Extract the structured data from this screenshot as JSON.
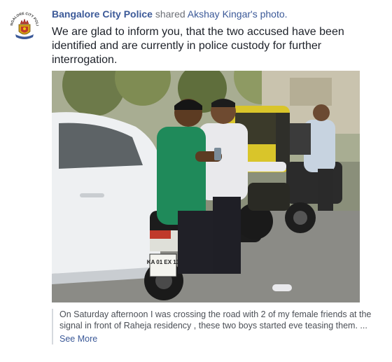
{
  "post": {
    "author": "Bangalore City Police",
    "action": "shared",
    "original_owner": "Akshay Kingar's",
    "object": "photo.",
    "message": "We are glad to inform you, that the two accused have been identified and are currently in police custody for further interrogation.",
    "avatar_icon": "police-emblem-icon",
    "avatar_text": "BANGALORE CITY POLICE"
  },
  "photo": {
    "plate_text": "KA 01 EX 13"
  },
  "shared_text": {
    "body": "On Saturday afternoon I was crossing the road with 2 of my female friends at the signal in front of Raheja residency , these two boys started eve teasing them. ...",
    "see_more": "See More"
  },
  "colors": {
    "link": "#3b5998",
    "text": "#1d2129",
    "muted": "#6d7077",
    "rule": "#d6d9de"
  }
}
